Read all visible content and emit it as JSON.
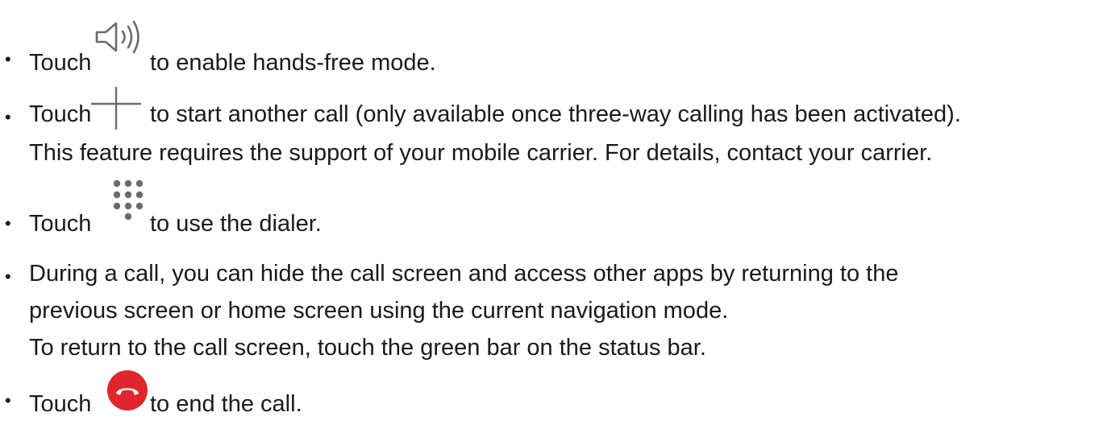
{
  "bullet_symbol": "•",
  "items": [
    {
      "pre": "Touch",
      "post": "to enable hands-free mode.",
      "icon": "speaker-icon"
    },
    {
      "pre": "Touch",
      "post": "to start another call (only available once three-way calling has been activated).",
      "line2": "This feature requires the support of your mobile carrier. For details, contact your carrier.",
      "icon": "plus-icon"
    },
    {
      "pre": "Touch",
      "post": "to use the dialer.",
      "icon": "dialpad-icon"
    },
    {
      "line1": "During a call, you can hide the call screen and access other apps by returning to the",
      "line2": "previous screen or home screen using the current navigation mode.",
      "line3": "To return to the call screen, touch the green bar on the status bar."
    },
    {
      "pre": "Touch",
      "post": "to end the call.",
      "icon": "end-call-icon"
    }
  ],
  "colors": {
    "text": "#1a1a1a",
    "icon": "#6b6b6b",
    "end_call": "#e0262d"
  }
}
